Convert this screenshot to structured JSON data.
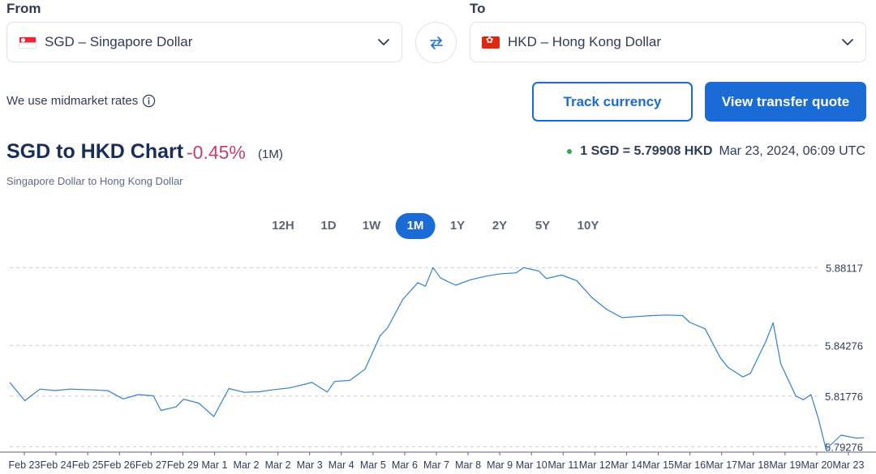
{
  "from": {
    "label": "From",
    "currency": "SGD – Singapore Dollar"
  },
  "to": {
    "label": "To",
    "currency": "HKD – Hong Kong Dollar"
  },
  "midmarket_text": "We use midmarket rates",
  "buttons": {
    "track": "Track currency",
    "quote": "View transfer quote"
  },
  "header": {
    "title": "SGD to HKD Chart",
    "change": "-0.45%",
    "period": "(1M)",
    "subtitle": "Singapore Dollar to Hong Kong Dollar",
    "rate": "1 SGD = 5.79908 HKD",
    "timestamp": "Mar 23, 2024, 06:09 UTC"
  },
  "ranges": [
    "12H",
    "1D",
    "1W",
    "1M",
    "1Y",
    "2Y",
    "5Y",
    "10Y"
  ],
  "active_range": "1M",
  "colors": {
    "accent": "#1a6bd6",
    "negative": "#c6416e",
    "line": "#2f80d0",
    "live_dot": "#2fa84f"
  },
  "chart_data": {
    "type": "line",
    "x": [
      "Feb 23",
      "Feb 24",
      "Feb 25",
      "Feb 26",
      "Feb 27",
      "Feb 29",
      "Mar 1",
      "Mar 2",
      "Mar 2",
      "Mar 3",
      "Mar 4",
      "Mar 5",
      "Mar 6",
      "Mar 7",
      "Mar 8",
      "Mar 9",
      "Mar 10",
      "Mar 11",
      "Mar 12",
      "Mar 14",
      "Mar 15",
      "Mar 16",
      "Mar 17",
      "Mar 18",
      "Mar 19",
      "Mar 20",
      "Mar 23"
    ],
    "y_ticks": [
      5.88117,
      5.84276,
      5.81776,
      5.79276
    ],
    "ylim": [
      5.7905,
      5.8825
    ],
    "series": [
      {
        "values": [
          [
            0,
            5.8245
          ],
          [
            0.02,
            5.8155
          ],
          [
            0.04,
            5.8212
          ],
          [
            0.06,
            5.8205
          ],
          [
            0.08,
            5.8212
          ],
          [
            0.11,
            5.8208
          ],
          [
            0.13,
            5.8204
          ],
          [
            0.15,
            5.8164
          ],
          [
            0.17,
            5.8185
          ],
          [
            0.19,
            5.8179
          ],
          [
            0.2,
            5.8107
          ],
          [
            0.22,
            5.8124
          ],
          [
            0.23,
            5.8162
          ],
          [
            0.25,
            5.8143
          ],
          [
            0.27,
            5.8077
          ],
          [
            0.29,
            5.8215
          ],
          [
            0.31,
            5.8196
          ],
          [
            0.33,
            5.8199
          ],
          [
            0.35,
            5.821
          ],
          [
            0.37,
            5.8218
          ],
          [
            0.4,
            5.8245
          ],
          [
            0.42,
            5.8198
          ],
          [
            0.43,
            5.825
          ],
          [
            0.45,
            5.8255
          ],
          [
            0.47,
            5.831
          ],
          [
            0.49,
            5.8475
          ],
          [
            0.5,
            5.8515
          ],
          [
            0.52,
            5.8655
          ],
          [
            0.54,
            5.8738
          ],
          [
            0.55,
            5.872
          ],
          [
            0.56,
            5.8812
          ],
          [
            0.57,
            5.876
          ],
          [
            0.59,
            5.8725
          ],
          [
            0.61,
            5.8752
          ],
          [
            0.63,
            5.877
          ],
          [
            0.65,
            5.8782
          ],
          [
            0.67,
            5.8786
          ],
          [
            0.68,
            5.8812
          ],
          [
            0.7,
            5.8795
          ],
          [
            0.71,
            5.8758
          ],
          [
            0.73,
            5.8775
          ],
          [
            0.75,
            5.8748
          ],
          [
            0.77,
            5.8665
          ],
          [
            0.79,
            5.8605
          ],
          [
            0.81,
            5.8565
          ],
          [
            0.83,
            5.857
          ],
          [
            0.85,
            5.8575
          ],
          [
            0.87,
            5.8578
          ],
          [
            0.89,
            5.8575
          ],
          [
            0.9,
            5.8541
          ],
          [
            0.92,
            5.851
          ],
          [
            0.94,
            5.8368
          ],
          [
            0.95,
            5.832
          ],
          [
            0.97,
            5.8272
          ],
          [
            0.98,
            5.829
          ],
          [
            1.0,
            5.8445
          ],
          [
            1.01,
            5.854
          ],
          [
            1.02,
            5.8338
          ],
          [
            1.04,
            5.8178
          ],
          [
            1.05,
            5.816
          ],
          [
            1.06,
            5.8185
          ],
          [
            1.07,
            5.8065
          ],
          [
            1.08,
            5.7915
          ],
          [
            1.1,
            5.7985
          ],
          [
            1.12,
            5.797
          ],
          [
            1.13,
            5.7972
          ]
        ]
      }
    ],
    "grid": "dashed-horizontal",
    "legend": "none"
  }
}
